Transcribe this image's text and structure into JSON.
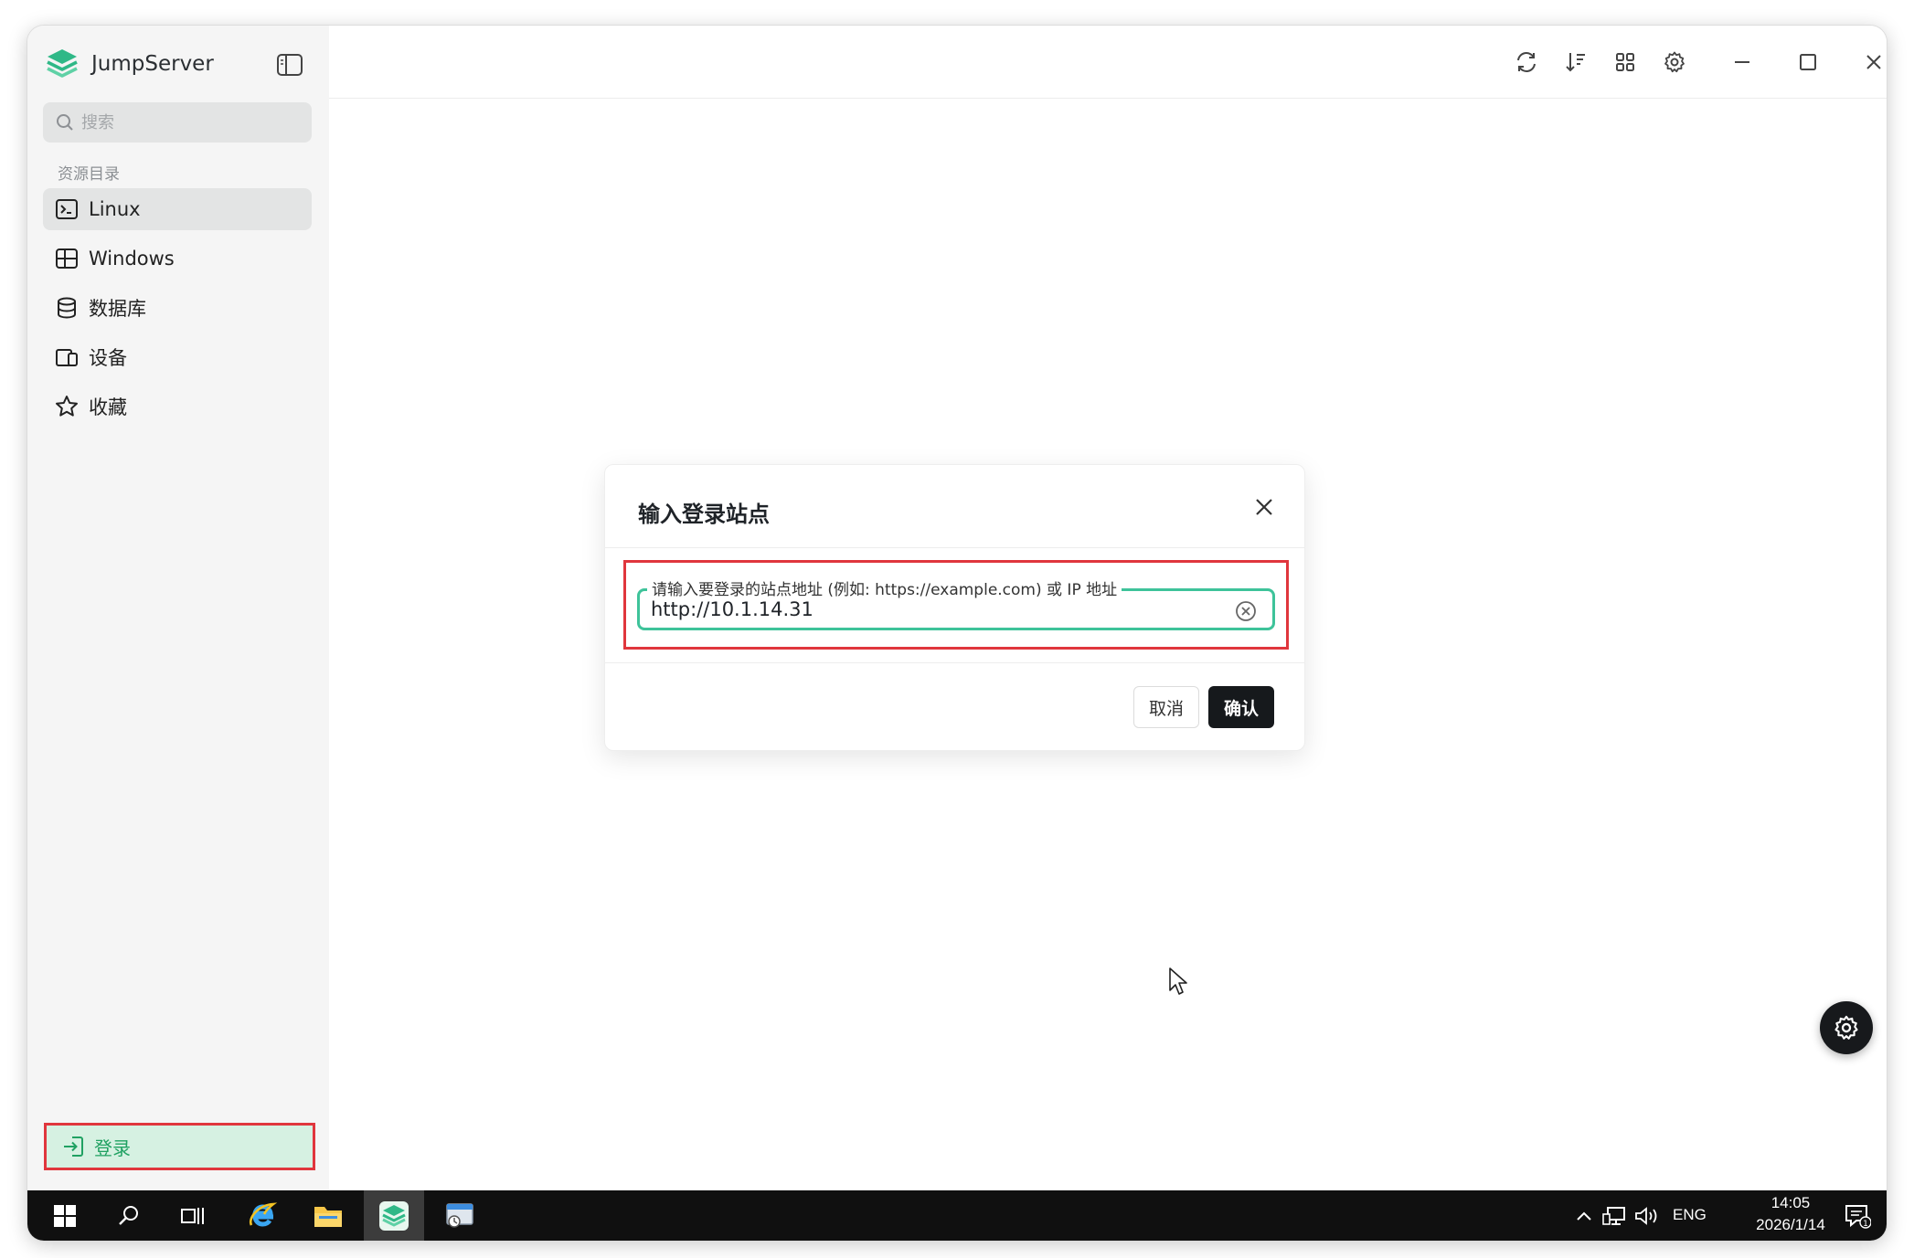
{
  "app": {
    "name": "JumpServer"
  },
  "search": {
    "placeholder": "搜索"
  },
  "sidebar": {
    "section_title": "资源目录",
    "items": [
      {
        "label": "Linux",
        "icon": "terminal-icon",
        "active": true
      },
      {
        "label": "Windows",
        "icon": "windows-icon",
        "active": false
      },
      {
        "label": "数据库",
        "icon": "database-icon",
        "active": false
      },
      {
        "label": "设备",
        "icon": "device-icon",
        "active": false
      },
      {
        "label": "收藏",
        "icon": "star-icon",
        "active": false
      }
    ],
    "login_label": "登录"
  },
  "toolbar": {
    "icons": [
      "refresh-icon",
      "sort-icon",
      "grid-icon",
      "settings-icon",
      "minimize-icon",
      "maximize-icon",
      "close-icon"
    ]
  },
  "dialog": {
    "title": "输入登录站点",
    "field_label": "请输入要登录的站点地址 (例如: https://example.com) 或 IP 地址",
    "field_value": "http://10.1.14.31",
    "cancel_label": "取消",
    "confirm_label": "确认"
  },
  "taskbar": {
    "language": "ENG",
    "time": "14:05",
    "date": "2026/1/14",
    "notification_count": "1"
  },
  "colors": {
    "accent": "#3ec39a",
    "highlight": "#e0363d",
    "login_bg": "#d6f1e2",
    "login_text": "#20a162",
    "primary_button": "#16191c"
  }
}
